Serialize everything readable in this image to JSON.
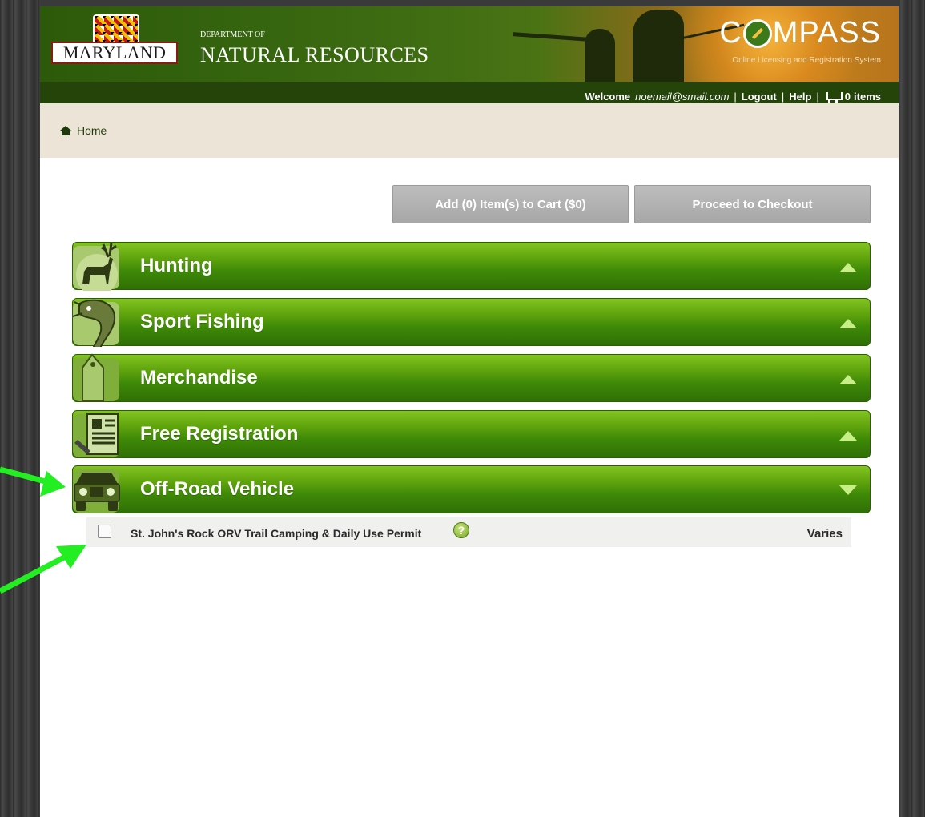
{
  "header": {
    "logo_text": "MARYLAND",
    "dept_small": "DEPARTMENT OF",
    "dept_big": "NATURAL RESOURCES",
    "app_title_start": "C",
    "app_title_end": "MPASS",
    "app_subtitle": "Online Licensing and Registration System"
  },
  "nav": {
    "welcome_label": "Welcome",
    "email": "noemail@smail.com",
    "logout": "Logout",
    "help": "Help",
    "cart_count": "0",
    "cart_label": "items",
    "separator": "|"
  },
  "breadcrumb": {
    "home": "Home"
  },
  "actions": {
    "add_to_cart": "Add (0) Item(s) to Cart ($0)",
    "checkout": "Proceed to Checkout"
  },
  "categories": [
    {
      "label": "Hunting",
      "icon": "deer-icon",
      "expanded": false
    },
    {
      "label": "Sport Fishing",
      "icon": "fish-icon",
      "expanded": false
    },
    {
      "label": "Merchandise",
      "icon": "tag-icon",
      "expanded": false
    },
    {
      "label": "Free Registration",
      "icon": "id-card-icon",
      "expanded": false
    },
    {
      "label": "Off-Road Vehicle",
      "icon": "jeep-icon",
      "expanded": true
    }
  ],
  "items": [
    {
      "label": "St. John's Rock ORV Trail Camping & Daily Use Permit",
      "price": "Varies",
      "checked": false,
      "help_glyph": "?"
    }
  ],
  "colors": {
    "header_green": "#2c5a0a",
    "nav_dark": "#24440a",
    "category_green": "#5ea20c",
    "annotation_arrow": "#22ee22"
  }
}
